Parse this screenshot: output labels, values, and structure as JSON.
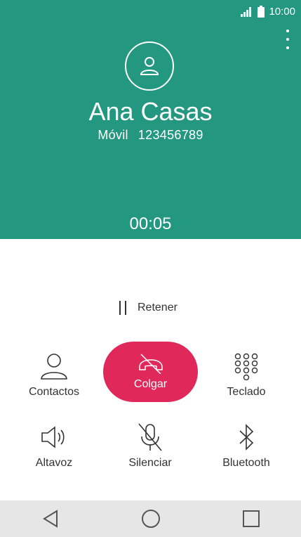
{
  "status_bar": {
    "time": "10:00",
    "icons": [
      "signal-icon",
      "battery-icon"
    ]
  },
  "caller": {
    "name": "Ana Casas",
    "number_type": "Móvil",
    "number": "123456789",
    "icon": "person-icon"
  },
  "call": {
    "duration": "00:05"
  },
  "hold": {
    "label": "Retener",
    "icon": "pause-icon"
  },
  "actions": {
    "contacts": {
      "label": "Contactos",
      "icon": "contact-icon"
    },
    "hangup": {
      "label": "Colgar",
      "icon": "end-call-icon"
    },
    "keypad": {
      "label": "Teclado",
      "icon": "dialpad-icon"
    },
    "speaker": {
      "label": "Altavoz",
      "icon": "speaker-icon"
    },
    "mute": {
      "label": "Silenciar",
      "icon": "mic-off-icon"
    },
    "bluetooth": {
      "label": "Bluetooth",
      "icon": "bluetooth-icon"
    }
  },
  "nav": {
    "icons": [
      "back-icon",
      "home-icon",
      "recents-icon"
    ]
  },
  "colors": {
    "header": "#23977f",
    "hangup": "#e0285a",
    "navbar": "#e6e6e6"
  }
}
